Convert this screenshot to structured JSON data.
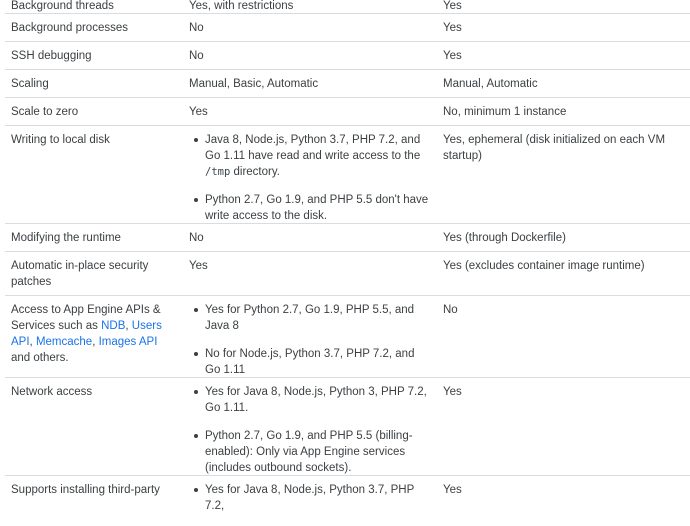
{
  "rows": [
    {
      "label": "Background threads",
      "col2": "Yes, with restrictions",
      "col3": "Yes"
    },
    {
      "label": "Background processes",
      "col2": "No",
      "col3": "Yes"
    },
    {
      "label": "SSH debugging",
      "col2": "No",
      "col3": "Yes"
    },
    {
      "label": "Scaling",
      "col2": "Manual, Basic, Automatic",
      "col3": "Manual, Automatic"
    },
    {
      "label": "Scale to zero",
      "col2": "Yes",
      "col3": "No, minimum 1 instance"
    },
    {
      "label": "Writing to local disk",
      "col2_items": [
        {
          "pre": "Java 8, Node.js, Python 3.7, PHP 7.2, and Go 1.11 have read and write access to the ",
          "code": "/tmp",
          "post": " directory."
        },
        {
          "text": "Python 2.7, Go 1.9, and PHP 5.5 don't have write access to the disk."
        }
      ],
      "col3": "Yes, ephemeral (disk initialized on each VM startup)"
    },
    {
      "label": "Modifying the runtime",
      "col2": "No",
      "col3": "Yes (through Dockerfile)"
    },
    {
      "label": "Automatic in-place security patches",
      "col2": "Yes",
      "col3": "Yes (excludes container image runtime)"
    },
    {
      "label_pre": "Access to App Engine APIs & Services such as ",
      "label_links": [
        "NDB",
        "Users API",
        "Memcache",
        "Images API"
      ],
      "label_sep1": ", ",
      "label_sep2": ",",
      "label_sep3": ", ",
      "label_and": " and",
      "label_post": "others.",
      "col2_items": [
        {
          "text": "Yes for Python 2.7, Go 1.9, PHP 5.5, and Java 8"
        },
        {
          "text": "No for Node.js, Python 3.7, PHP 7.2, and Go 1.11"
        }
      ],
      "col3": "No"
    },
    {
      "label": "Network access",
      "col2_items": [
        {
          "text": "Yes for Java 8, Node.js, Python 3, PHP 7.2, Go 1.11."
        },
        {
          "text": "Python 2.7, Go 1.9, and PHP 5.5 (billing-enabled): Only via App Engine services (includes outbound sockets)."
        }
      ],
      "col3": "Yes"
    },
    {
      "label": "Supports installing third-party",
      "col2_items": [
        {
          "text": "Yes for Java 8, Node.js, Python 3.7, PHP 7.2,"
        }
      ],
      "col3": "Yes"
    }
  ]
}
